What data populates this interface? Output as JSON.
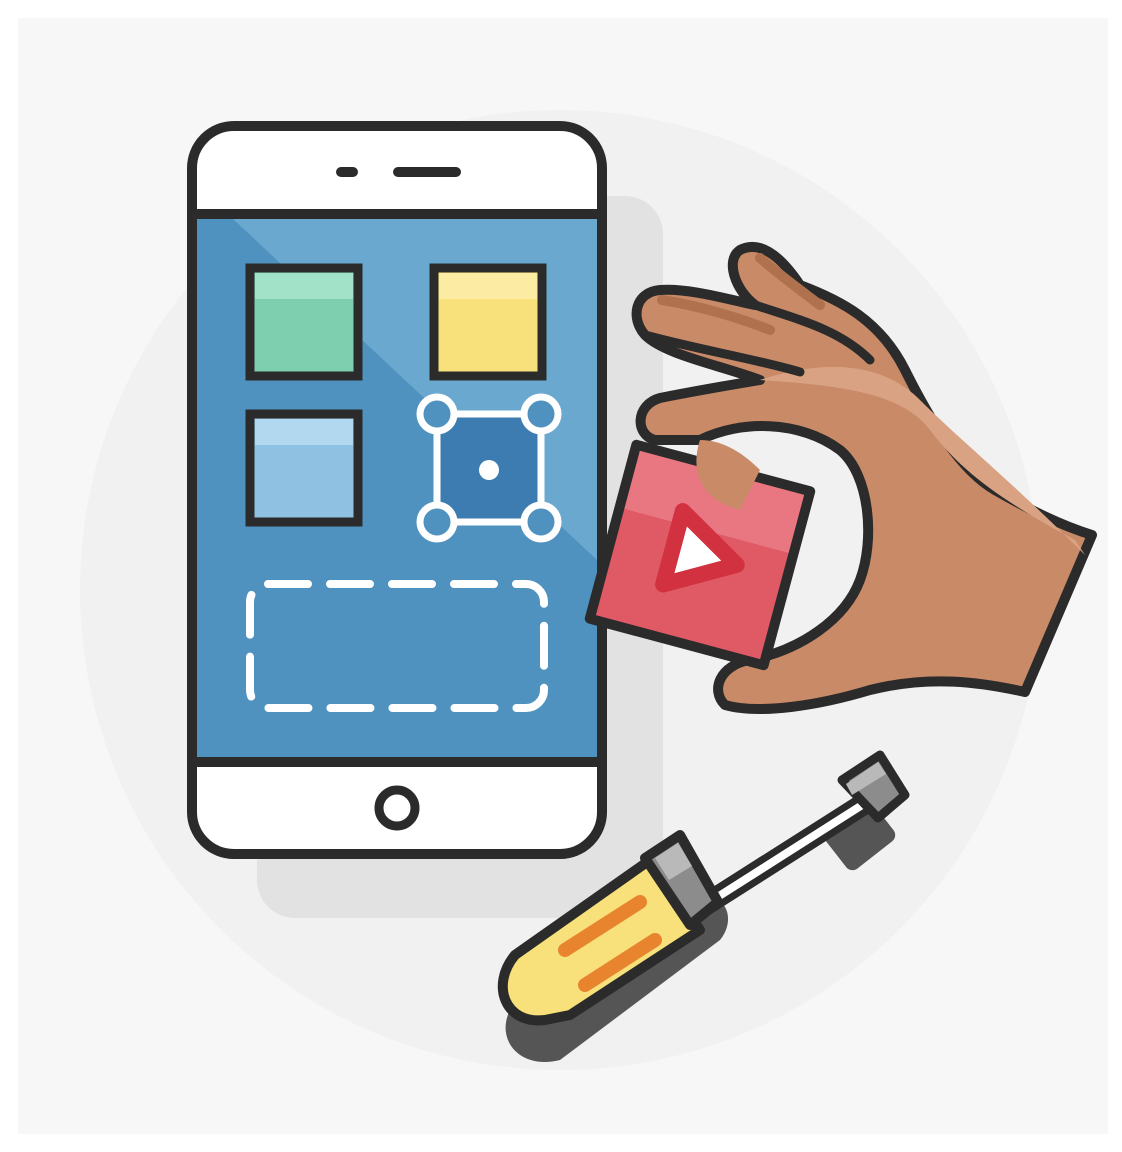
{
  "illustration": {
    "subject": "app-builder-illustration",
    "colors": {
      "panel_background": "#f7f7f7",
      "backdrop_circle": "#f1f1f1",
      "phone_shadow": "#e2e2e2",
      "outline": "#2b2b2b",
      "phone_body": "#ffffff",
      "screen_blue": "#4f92bf",
      "screen_highlight": "#6aa8cf",
      "tile_green": "#7ecfb0",
      "tile_yellow": "#f8e07a",
      "tile_light_blue": "#8fc1e2",
      "selected_tile": "#3d7cb0",
      "video_block": "#e05a66",
      "video_block_dark": "#d23140",
      "hand_skin": "#c98a68",
      "hand_skin_shadow": "#b0714f",
      "screwdriver_handle": "#f8e07a",
      "screwdriver_stripe": "#e8832e",
      "screwdriver_metal": "#8c8c8c"
    },
    "icons": [
      "smartphone-icon",
      "app-tile-icon",
      "selection-handles-icon",
      "video-play-block-icon",
      "hand-icon",
      "screwdriver-icon"
    ]
  }
}
